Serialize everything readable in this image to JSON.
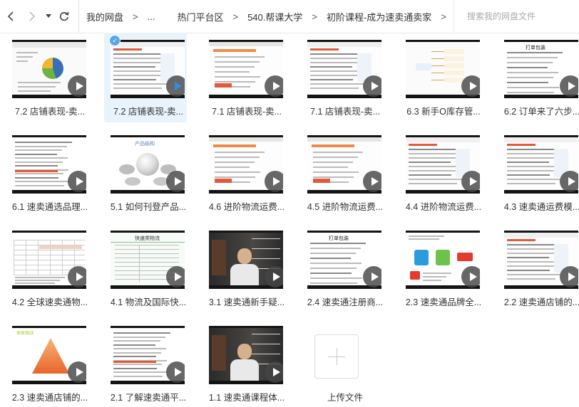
{
  "nav": {
    "breadcrumbs": [
      "我的网盘",
      "...",
      "热门平台区",
      "540.帮课大学",
      "初阶课程-成为速卖通卖家"
    ],
    "separator": ">"
  },
  "search": {
    "placeholder": "搜索我的网盘文件"
  },
  "files": [
    {
      "name": "7.2 店铺表现-卖...",
      "selected": false,
      "thumb": "dashboard-piechart"
    },
    {
      "name": "7.2 店铺表现-卖...",
      "selected": true,
      "thumb": "web-table"
    },
    {
      "name": "7.1 店铺表现-卖...",
      "selected": false,
      "thumb": "web-form"
    },
    {
      "name": "7.1 店铺表现-卖...",
      "selected": false,
      "thumb": "web-table"
    },
    {
      "name": "6.3 新手O库存管...",
      "selected": false,
      "thumb": "mindmap"
    },
    {
      "name": "6.2 订单来了六步...",
      "selected": false,
      "thumb": "text-slide"
    },
    {
      "name": "6.1 速卖通选品理...",
      "selected": false,
      "thumb": "text-dense"
    },
    {
      "name": "5.1 如何刊登产品...",
      "selected": false,
      "thumb": "product-diagram"
    },
    {
      "name": "4.6 进阶物流运费...",
      "selected": false,
      "thumb": "web-form"
    },
    {
      "name": "4.5 进阶物流运费...",
      "selected": false,
      "thumb": "web-form"
    },
    {
      "name": "4.4 进阶物流运费...",
      "selected": false,
      "thumb": "web-table"
    },
    {
      "name": "4.3 速卖通运费模...",
      "selected": false,
      "thumb": "web-table"
    },
    {
      "name": "4.2 全球速卖通物...",
      "selected": false,
      "thumb": "table-grid"
    },
    {
      "name": "4.1 物流及国际快...",
      "selected": false,
      "thumb": "express-table"
    },
    {
      "name": "3.1 速卖通新手疑...",
      "selected": false,
      "thumb": "presenter"
    },
    {
      "name": "2.4 速卖通注册商...",
      "selected": false,
      "thumb": "text-slide"
    },
    {
      "name": "2.3 速卖通品牌全...",
      "selected": false,
      "thumb": "brand-icons"
    },
    {
      "name": "2.2 速卖通店铺的...",
      "selected": false,
      "thumb": "web-table"
    },
    {
      "name": "2.3 速卖通店铺的...",
      "selected": false,
      "thumb": "pyramid"
    },
    {
      "name": "2.1 了解速卖通平...",
      "selected": false,
      "thumb": "text-dense"
    },
    {
      "name": "1.1 速卖通课程体...",
      "selected": false,
      "thumb": "presenter"
    }
  ],
  "upload": {
    "label": "上传文件"
  },
  "thumb_texts": {
    "product_diagram_title": "产品结构",
    "express_title": "快速类物流",
    "pyramid_title": "卖家挑战",
    "text_slide_title": "打单包装"
  },
  "colors": {
    "accent": "#2c8ee8",
    "selected_bg": "#e8f3fc",
    "check": "#5aa7e8"
  }
}
